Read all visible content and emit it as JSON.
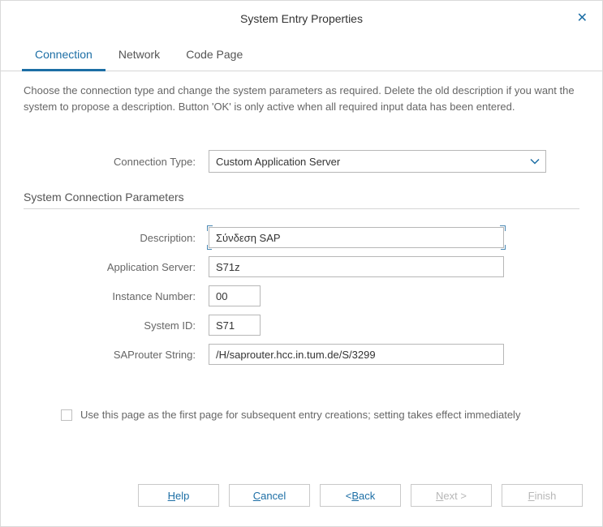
{
  "dialog": {
    "title": "System Entry Properties"
  },
  "close": {
    "glyph": "✕"
  },
  "tabs": {
    "connection": "Connection",
    "network": "Network",
    "codepage": "Code Page"
  },
  "intro": "Choose the connection type and change the system parameters as required. Delete the old description if you want the system to propose a description. Button 'OK' is only active when all required input data has been entered.",
  "connection_type": {
    "label": "Connection Type:",
    "value": "Custom Application Server"
  },
  "section": "System Connection Parameters",
  "fields": {
    "description": {
      "label": "Description:",
      "value": "Σύνδεση SAP"
    },
    "app_server": {
      "label": "Application Server:",
      "value": "S71z"
    },
    "instance_no": {
      "label": "Instance Number:",
      "value": "00"
    },
    "system_id": {
      "label": "System ID:",
      "value": "S71"
    },
    "saprouter": {
      "label": "SAProuter String:",
      "value": "/H/saprouter.hcc.in.tum.de/S/3299"
    }
  },
  "checkbox": {
    "label": "Use this page as the first page for subsequent entry creations; setting takes effect immediately"
  },
  "buttons": {
    "help": {
      "pre": "",
      "mn": "H",
      "post": "elp"
    },
    "cancel": {
      "pre": "",
      "mn": "C",
      "post": "ancel"
    },
    "back": {
      "pre": "< ",
      "mn": "B",
      "post": "ack"
    },
    "next": {
      "pre": "",
      "mn": "N",
      "post": "ext >"
    },
    "finish": {
      "pre": "",
      "mn": "F",
      "post": "inish"
    }
  }
}
